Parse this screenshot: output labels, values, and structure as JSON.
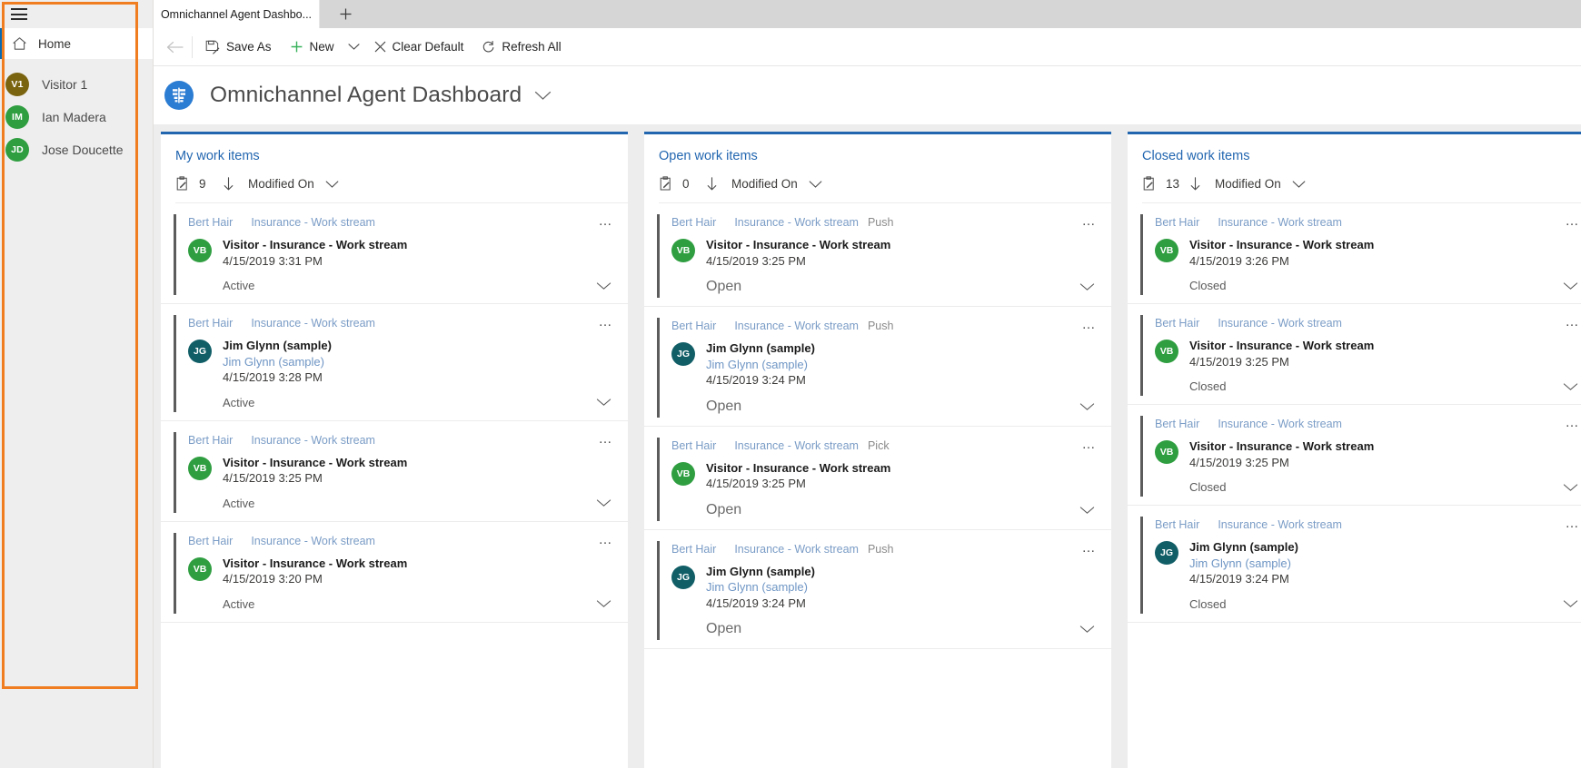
{
  "sidebar": {
    "hamburger_icon": "hamburger-menu-icon",
    "home": {
      "label": "Home",
      "icon": "home-icon"
    },
    "people": [
      {
        "initials": "V1",
        "name": "Visitor 1",
        "color": "#7a6410"
      },
      {
        "initials": "IM",
        "name": "Ian Madera",
        "color": "#2f9e41"
      },
      {
        "initials": "JD",
        "name": "Jose Doucette",
        "color": "#2f9e41"
      }
    ]
  },
  "tabstrip": {
    "tab_title": "Omnichannel Agent Dashbo...",
    "new_tab_label": "+",
    "new_tab_icon": "plus-icon"
  },
  "commandbar": {
    "back_icon": "back-arrow-icon",
    "save_as": {
      "label": "Save As",
      "icon": "save-as-icon"
    },
    "new": {
      "label": "New",
      "icon": "plus-icon"
    },
    "new_caret_icon": "chevron-down-icon",
    "clear_default": {
      "label": "Clear Default",
      "icon": "close-x-icon"
    },
    "refresh_all": {
      "label": "Refresh All",
      "icon": "refresh-icon"
    }
  },
  "pageheader": {
    "icon": "dashboard-icon",
    "title": "Omnichannel Agent Dashboard",
    "caret_icon": "chevron-down-icon"
  },
  "colors": {
    "accent_blue": "#2266b0",
    "link_blue": "#7a9cc6",
    "highlight_orange": "#f07d20",
    "avatar_green": "#2f9e41",
    "avatar_teal": "#115e67"
  },
  "streams": [
    {
      "title": "My work items",
      "count": "9",
      "count_icon": "clipboard-icon",
      "sort_arrow_icon": "arrow-down-icon",
      "sort_label": "Modified On",
      "sort_caret_icon": "chevron-down-icon",
      "status_style": "normal",
      "cards": [
        {
          "customer": "Bert Hair",
          "stream": "Insurance - Work stream",
          "mode": "",
          "initials": "VB",
          "avatar_color": "#2f9e41",
          "line1": "Visitor - Insurance - Work stream",
          "line2": "",
          "line3": "4/15/2019 3:31 PM",
          "status": "Active",
          "ellipsis": "…",
          "chevron_icon": "chevron-down-icon"
        },
        {
          "customer": "Bert Hair",
          "stream": "Insurance - Work stream",
          "mode": "",
          "initials": "JG",
          "avatar_color": "#115e67",
          "line1": "Jim Glynn (sample)",
          "line2": "Jim Glynn (sample)",
          "line3": "4/15/2019 3:28 PM",
          "status": "Active",
          "ellipsis": "…",
          "chevron_icon": "chevron-down-icon"
        },
        {
          "customer": "Bert Hair",
          "stream": "Insurance - Work stream",
          "mode": "",
          "initials": "VB",
          "avatar_color": "#2f9e41",
          "line1": "Visitor - Insurance - Work stream",
          "line2": "",
          "line3": "4/15/2019 3:25 PM",
          "status": "Active",
          "ellipsis": "…",
          "chevron_icon": "chevron-down-icon"
        },
        {
          "customer": "Bert Hair",
          "stream": "Insurance - Work stream",
          "mode": "",
          "initials": "VB",
          "avatar_color": "#2f9e41",
          "line1": "Visitor - Insurance - Work stream",
          "line2": "",
          "line3": "4/15/2019 3:20 PM",
          "status": "Active",
          "ellipsis": "…",
          "chevron_icon": "chevron-down-icon"
        }
      ]
    },
    {
      "title": "Open work items",
      "count": "0",
      "count_icon": "clipboard-icon",
      "sort_arrow_icon": "arrow-down-icon",
      "sort_label": "Modified On",
      "sort_caret_icon": "chevron-down-icon",
      "status_style": "big",
      "cards": [
        {
          "customer": "Bert Hair",
          "stream": "Insurance - Work stream",
          "mode": "Push",
          "initials": "VB",
          "avatar_color": "#2f9e41",
          "line1": "Visitor - Insurance - Work stream",
          "line2": "",
          "line3": "4/15/2019 3:25 PM",
          "status": "Open",
          "ellipsis": "…",
          "chevron_icon": "chevron-down-icon"
        },
        {
          "customer": "Bert Hair",
          "stream": "Insurance - Work stream",
          "mode": "Push",
          "initials": "JG",
          "avatar_color": "#115e67",
          "line1": "Jim Glynn (sample)",
          "line2": "Jim Glynn (sample)",
          "line3": "4/15/2019 3:24 PM",
          "status": "Open",
          "ellipsis": "…",
          "chevron_icon": "chevron-down-icon"
        },
        {
          "customer": "Bert Hair",
          "stream": "Insurance - Work stream",
          "mode": "Pick",
          "initials": "VB",
          "avatar_color": "#2f9e41",
          "line1": "Visitor - Insurance - Work stream",
          "line2": "",
          "line3": "4/15/2019 3:25 PM",
          "status": "Open",
          "ellipsis": "…",
          "chevron_icon": "chevron-down-icon"
        },
        {
          "customer": "Bert Hair",
          "stream": "Insurance - Work stream",
          "mode": "Push",
          "initials": "JG",
          "avatar_color": "#115e67",
          "line1": "Jim Glynn (sample)",
          "line2": "Jim Glynn (sample)",
          "line3": "4/15/2019 3:24 PM",
          "status": "Open",
          "ellipsis": "…",
          "chevron_icon": "chevron-down-icon"
        }
      ]
    },
    {
      "title": "Closed work items",
      "count": "13",
      "count_icon": "clipboard-icon",
      "sort_arrow_icon": "arrow-down-icon",
      "sort_label": "Modified On",
      "sort_caret_icon": "chevron-down-icon",
      "status_style": "normal",
      "cards": [
        {
          "customer": "Bert Hair",
          "stream": "Insurance - Work stream",
          "mode": "",
          "initials": "VB",
          "avatar_color": "#2f9e41",
          "line1": "Visitor - Insurance - Work stream",
          "line2": "",
          "line3": "4/15/2019 3:26 PM",
          "status": "Closed",
          "ellipsis": "…",
          "chevron_icon": "chevron-down-icon"
        },
        {
          "customer": "Bert Hair",
          "stream": "Insurance - Work stream",
          "mode": "",
          "initials": "VB",
          "avatar_color": "#2f9e41",
          "line1": "Visitor - Insurance - Work stream",
          "line2": "",
          "line3": "4/15/2019 3:25 PM",
          "status": "Closed",
          "ellipsis": "…",
          "chevron_icon": "chevron-down-icon"
        },
        {
          "customer": "Bert Hair",
          "stream": "Insurance - Work stream",
          "mode": "",
          "initials": "VB",
          "avatar_color": "#2f9e41",
          "line1": "Visitor - Insurance - Work stream",
          "line2": "",
          "line3": "4/15/2019 3:25 PM",
          "status": "Closed",
          "ellipsis": "…",
          "chevron_icon": "chevron-down-icon"
        },
        {
          "customer": "Bert Hair",
          "stream": "Insurance - Work stream",
          "mode": "",
          "initials": "JG",
          "avatar_color": "#115e67",
          "line1": "Jim Glynn (sample)",
          "line2": "Jim Glynn (sample)",
          "line3": "4/15/2019 3:24 PM",
          "status": "Closed",
          "ellipsis": "…",
          "chevron_icon": "chevron-down-icon"
        }
      ]
    }
  ]
}
